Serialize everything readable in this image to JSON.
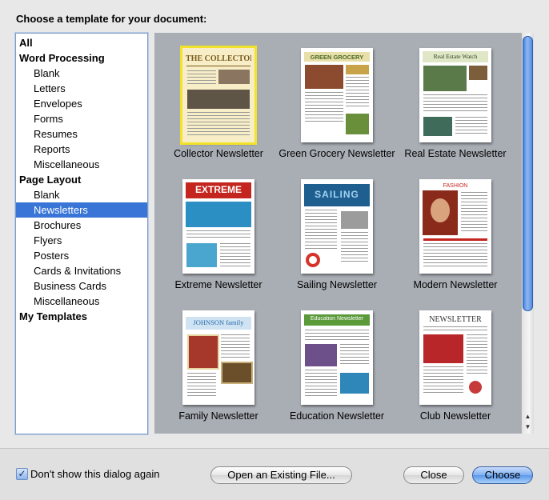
{
  "dialog": {
    "title": "Choose a template for your document:"
  },
  "categories": [
    {
      "label": "All",
      "level": "group",
      "selected": false
    },
    {
      "label": "Word Processing",
      "level": "group",
      "selected": false
    },
    {
      "label": "Blank",
      "level": "sub",
      "selected": false
    },
    {
      "label": "Letters",
      "level": "sub",
      "selected": false
    },
    {
      "label": "Envelopes",
      "level": "sub",
      "selected": false
    },
    {
      "label": "Forms",
      "level": "sub",
      "selected": false
    },
    {
      "label": "Resumes",
      "level": "sub",
      "selected": false
    },
    {
      "label": "Reports",
      "level": "sub",
      "selected": false
    },
    {
      "label": "Miscellaneous",
      "level": "sub",
      "selected": false
    },
    {
      "label": "Page Layout",
      "level": "group",
      "selected": false
    },
    {
      "label": "Blank",
      "level": "sub",
      "selected": false
    },
    {
      "label": "Newsletters",
      "level": "sub",
      "selected": true
    },
    {
      "label": "Brochures",
      "level": "sub",
      "selected": false
    },
    {
      "label": "Flyers",
      "level": "sub",
      "selected": false
    },
    {
      "label": "Posters",
      "level": "sub",
      "selected": false
    },
    {
      "label": "Cards & Invitations",
      "level": "sub",
      "selected": false
    },
    {
      "label": "Business Cards",
      "level": "sub",
      "selected": false
    },
    {
      "label": "Miscellaneous",
      "level": "sub",
      "selected": false
    },
    {
      "label": "My Templates",
      "level": "group",
      "selected": false
    }
  ],
  "templates": [
    {
      "name": "Collector Newsletter",
      "masthead": "THE COLLECTOR",
      "selected": true
    },
    {
      "name": "Green Grocery Newsletter",
      "masthead": "GREEN GROCERY",
      "selected": false
    },
    {
      "name": "Real Estate Newsletter",
      "masthead": "Real Estate Watch",
      "selected": false
    },
    {
      "name": "Extreme Newsletter",
      "masthead": "EXTREME",
      "selected": false
    },
    {
      "name": "Sailing Newsletter",
      "masthead": "SAILING",
      "selected": false
    },
    {
      "name": "Modern Newsletter",
      "masthead": "FASHION",
      "selected": false
    },
    {
      "name": "Family Newsletter",
      "masthead": "JOHNSON family",
      "selected": false
    },
    {
      "name": "Education Newsletter",
      "masthead": "Education Newsletter",
      "selected": false
    },
    {
      "name": "Club Newsletter",
      "masthead": "NEWSLETTER",
      "selected": false
    }
  ],
  "footer": {
    "dont_show_label": "Don't show this dialog again",
    "dont_show_checked": true,
    "checkmark": "✓",
    "open_existing_label": "Open an Existing File...",
    "close_label": "Close",
    "choose_label": "Choose"
  },
  "scrollbar": {
    "up_arrow": "▲",
    "down_arrow": "▼"
  },
  "colors": {
    "selection": "#3875d7",
    "pane_background": "#a9aeb5",
    "selected_template_outline": "#f2e32a"
  }
}
